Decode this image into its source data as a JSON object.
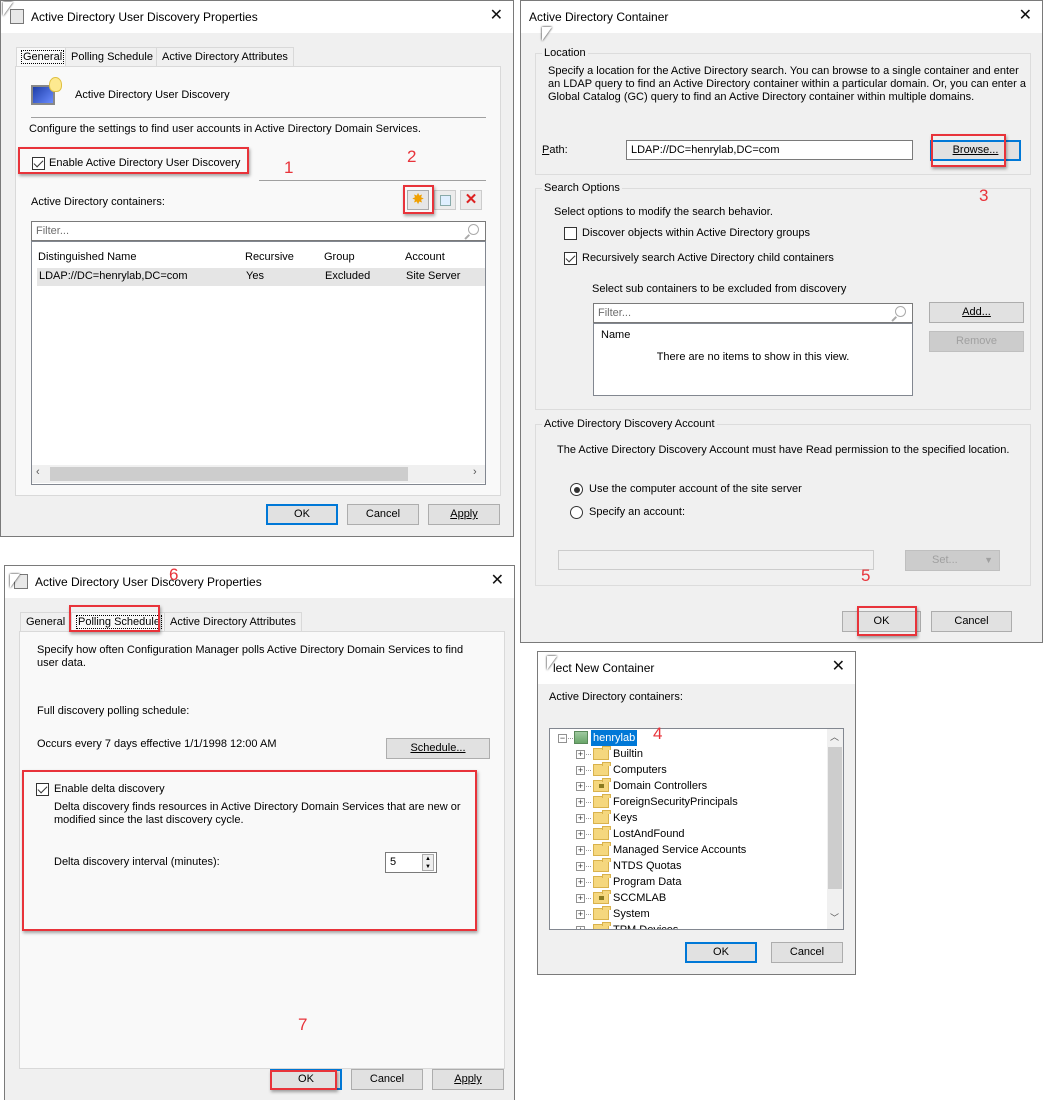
{
  "dialog1": {
    "title": "Active Directory User Discovery Properties",
    "tabs": [
      "General",
      "Polling Schedule",
      "Active Directory Attributes"
    ],
    "active_tab": "General",
    "header_text": "Active Directory User Discovery",
    "description": "Configure the settings to find user accounts in Active Directory Domain Services.",
    "enable_checkbox": {
      "label": "Enable Active Directory User Discovery",
      "checked": true
    },
    "containers_label": "Active Directory containers:",
    "toolbar": {
      "new": "new-icon",
      "properties": "properties-icon",
      "delete": "delete-icon"
    },
    "filter_placeholder": "Filter...",
    "columns": [
      "Distinguished Name",
      "Recursive",
      "Group",
      "Account"
    ],
    "rows": [
      [
        "LDAP://DC=henrylab,DC=com",
        "Yes",
        "Excluded",
        "Site Server"
      ]
    ],
    "buttons": {
      "ok": "OK",
      "cancel": "Cancel",
      "apply": "Apply"
    }
  },
  "dialog2": {
    "title": "Active Directory Container",
    "location_group": "Location",
    "location_text": "Specify a location for the Active Directory search. You can browse to a single container and enter an LDAP query to find an Active Directory container within a particular domain. Or, you can enter a Global Catalog (GC) query to find an Active Directory container within multiple domains.",
    "path_label": "Path:",
    "path_value": "LDAP://DC=henrylab,DC=com",
    "browse_label": "Browse...",
    "search_group": "Search Options",
    "search_text": "Select options to modify the search behavior.",
    "discover_groups": {
      "label": "Discover objects within Active Directory groups",
      "checked": false
    },
    "recursive": {
      "label": "Recursively search Active Directory child containers",
      "checked": true
    },
    "exclude_label": "Select sub containers to be excluded from discovery",
    "filter_placeholder": "Filter...",
    "name_column": "Name",
    "empty_text": "There are no items to show in this view.",
    "add_label": "Add...",
    "remove_label": "Remove",
    "account_group": "Active Directory Discovery Account",
    "account_text": "The Active Directory Discovery Account must have Read permission to the specified location.",
    "radio_computer": {
      "label": "Use the computer account of the site server",
      "checked": true
    },
    "radio_specify": {
      "label": "Specify an account:",
      "checked": false
    },
    "account_value": "",
    "set_label": "Set...",
    "buttons": {
      "ok": "OK",
      "cancel": "Cancel"
    }
  },
  "dialog3": {
    "title": "Active Directory User Discovery Properties",
    "tabs": [
      "General",
      "Polling Schedule",
      "Active Directory Attributes"
    ],
    "active_tab": "Polling Schedule",
    "description": "Specify how often Configuration Manager polls Active Directory Domain Services to find user data.",
    "full_label": "Full discovery polling schedule:",
    "schedule_text": "Occurs every 7 days effective 1/1/1998 12:00 AM",
    "schedule_button": "Schedule...",
    "delta_checkbox": {
      "label": "Enable delta discovery",
      "checked": true
    },
    "delta_text": "Delta discovery finds resources in Active Directory Domain Services that are new or modified since the last discovery cycle.",
    "interval_label": "Delta discovery interval (minutes):",
    "interval_value": "5",
    "buttons": {
      "ok": "OK",
      "cancel": "Cancel",
      "apply": "Apply"
    }
  },
  "dialog4": {
    "title": "Select New Container",
    "title_visible": "lect New Container",
    "containers_label": "Active Directory containers:",
    "root": "henrylab",
    "items": [
      {
        "name": "Builtin",
        "special": false
      },
      {
        "name": "Computers",
        "special": false
      },
      {
        "name": "Domain Controllers",
        "special": true
      },
      {
        "name": "ForeignSecurityPrincipals",
        "special": false
      },
      {
        "name": "Keys",
        "special": false
      },
      {
        "name": "LostAndFound",
        "special": false
      },
      {
        "name": "Managed Service Accounts",
        "special": false
      },
      {
        "name": "NTDS Quotas",
        "special": false
      },
      {
        "name": "Program Data",
        "special": false
      },
      {
        "name": "SCCMLAB",
        "special": true
      },
      {
        "name": "System",
        "special": false
      },
      {
        "name": "TPM Devices",
        "special": false
      }
    ],
    "buttons": {
      "ok": "OK",
      "cancel": "Cancel"
    }
  },
  "annotations": [
    "1",
    "2",
    "3",
    "4",
    "5",
    "6",
    "7"
  ],
  "colors": {
    "annotation": "#e8333a",
    "focus": "#0078d7",
    "selection": "#0078d7"
  }
}
